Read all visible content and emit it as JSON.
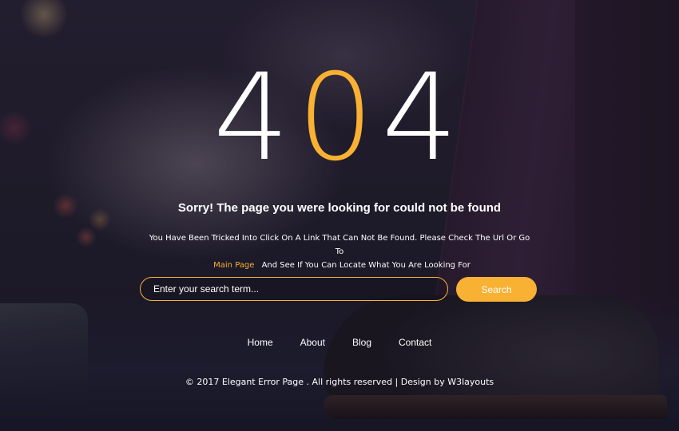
{
  "error": {
    "digit_left": "4",
    "digit_middle": "0",
    "digit_right": "4"
  },
  "headline": "Sorry! The page you were looking for could not be found",
  "description": {
    "line1": "You Have Been Tricked Into Click On A Link That Can Not Be Found. Please Check The Url Or Go To",
    "link_label": "Main Page",
    "line2": "And See If You Can Locate What You Are Looking For"
  },
  "search": {
    "placeholder": "Enter your search term...",
    "button_label": "Search"
  },
  "nav": {
    "items": [
      {
        "label": "Home"
      },
      {
        "label": "About"
      },
      {
        "label": "Blog"
      },
      {
        "label": "Contact"
      }
    ]
  },
  "footer": {
    "text": "© 2017 Elegant Error Page . All rights reserved | Design by W3layouts"
  },
  "colors": {
    "accent": "#f8b133",
    "text": "#ffffff"
  }
}
